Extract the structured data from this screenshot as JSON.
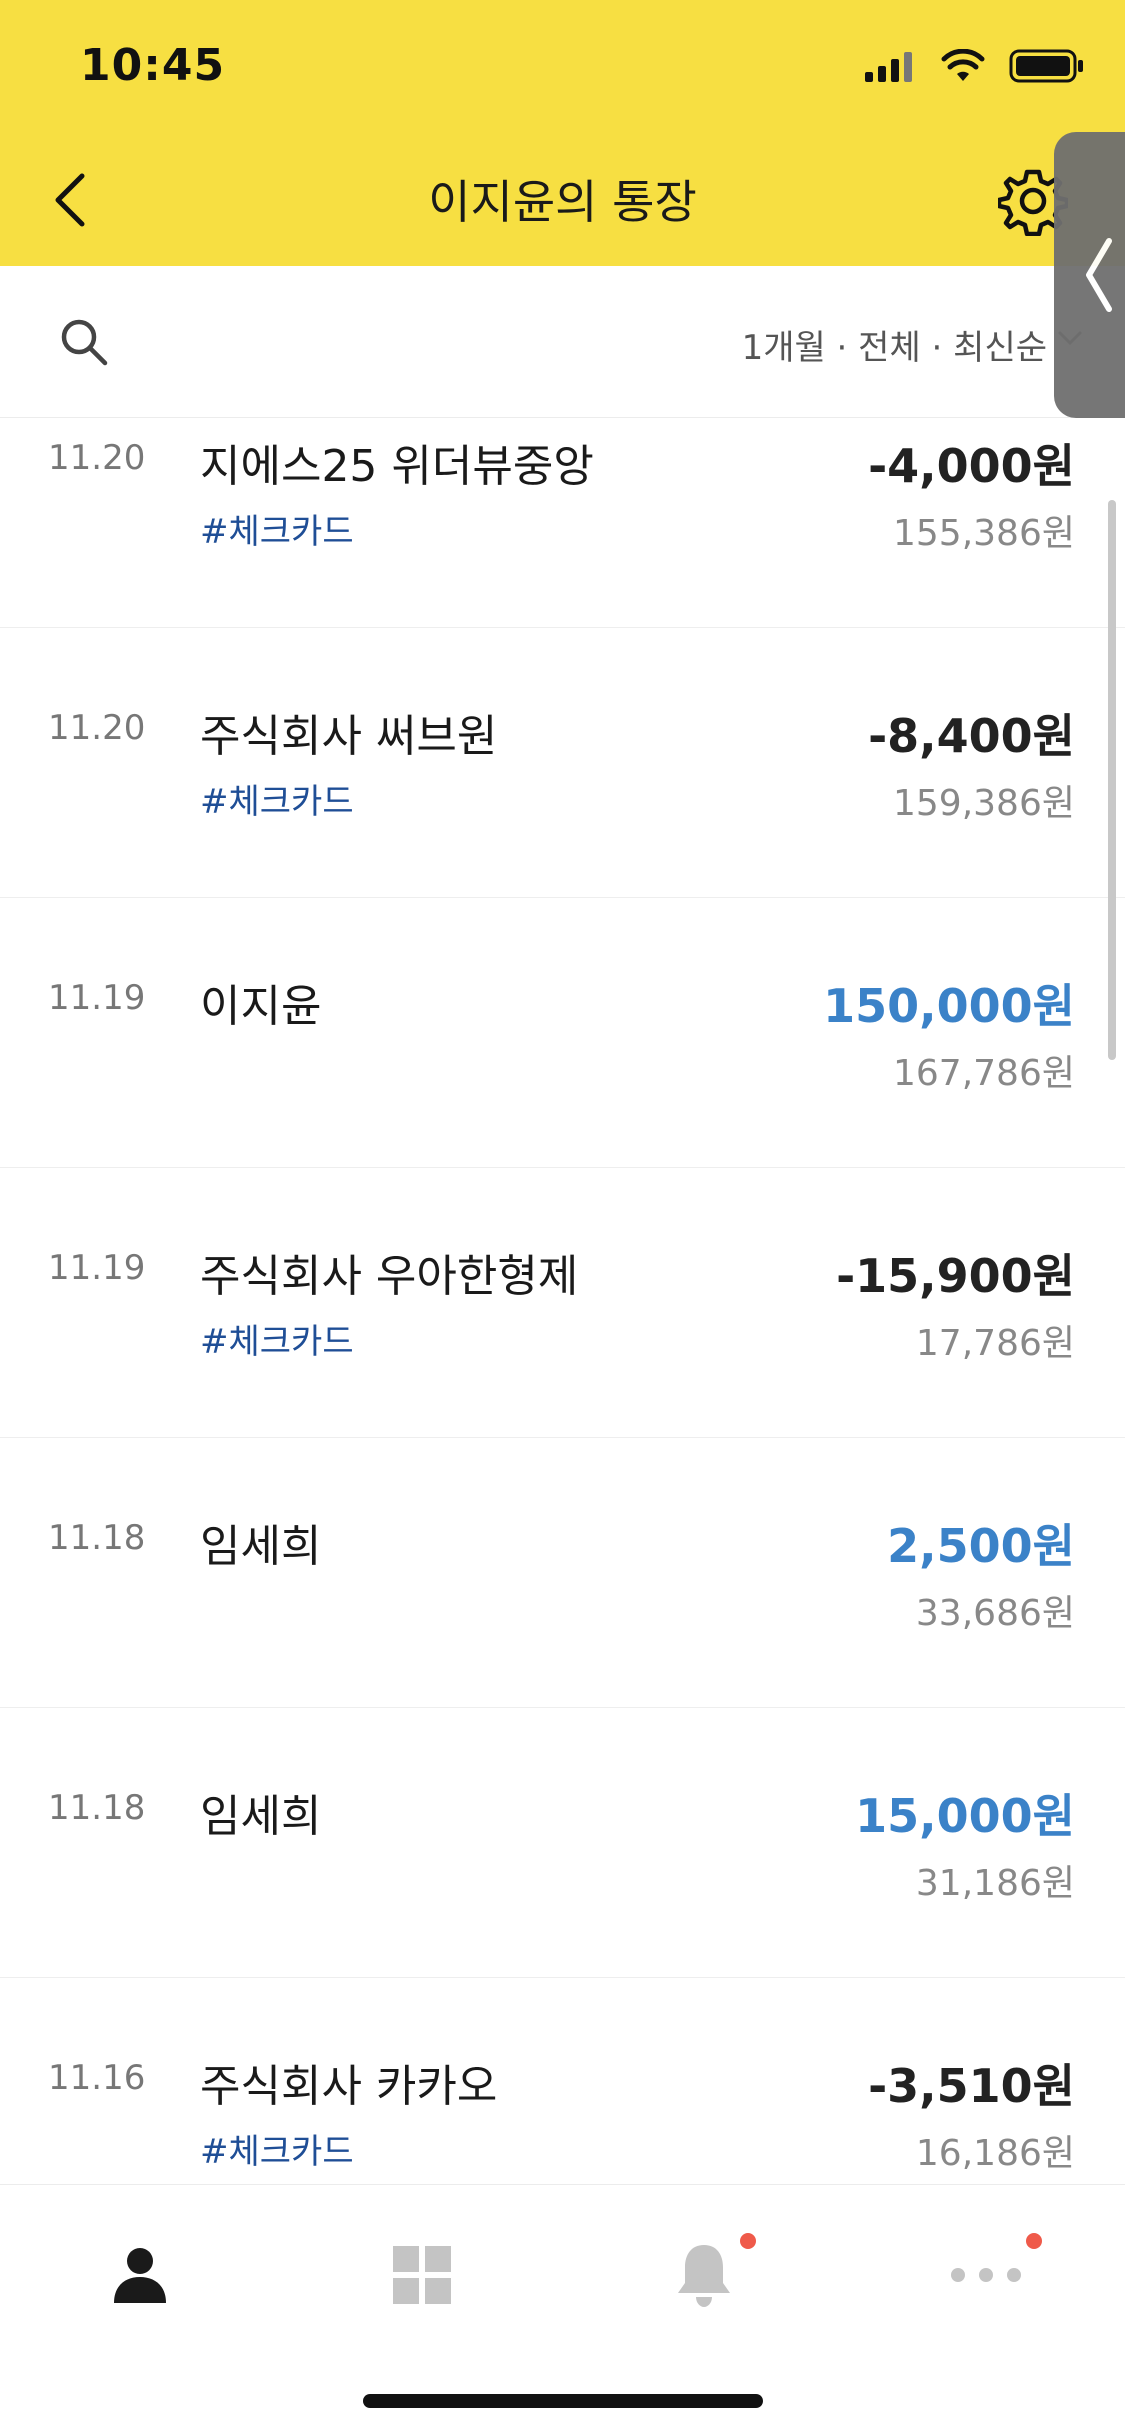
{
  "status_bar": {
    "time": "10:45"
  },
  "header": {
    "title": "이지윤의 통장"
  },
  "filter": {
    "label": "1개월 · 전체 · 최신순"
  },
  "transactions": [
    {
      "date": "11.20",
      "name": "지에스25 위더뷰중앙",
      "tag": "#체크카드",
      "amount": "-4,000원",
      "balance": "155,386원"
    },
    {
      "date": "11.20",
      "name": "주식회사 써브원",
      "tag": "#체크카드",
      "amount": "-8,400원",
      "balance": "159,386원"
    },
    {
      "date": "11.19",
      "name": "이지윤",
      "tag": "",
      "amount": "150,000원",
      "balance": "167,786원"
    },
    {
      "date": "11.19",
      "name": "주식회사 우아한형제",
      "tag": "#체크카드",
      "amount": "-15,900원",
      "balance": "17,786원"
    },
    {
      "date": "11.18",
      "name": "임세희",
      "tag": "",
      "amount": "2,500원",
      "balance": "33,686원"
    },
    {
      "date": "11.18",
      "name": "임세희",
      "tag": "",
      "amount": "15,000원",
      "balance": "31,186원"
    },
    {
      "date": "11.16",
      "name": "주식회사 카카오",
      "tag": "#체크카드",
      "amount": "-3,510원",
      "balance": "16,186원"
    }
  ],
  "colors": {
    "header_bg": "#f7df42",
    "positive_amount": "#3b82c8",
    "tag": "#1f4e96",
    "badge": "#ef5a4a"
  },
  "bottom_nav": [
    {
      "icon": "person-icon"
    },
    {
      "icon": "grid-icon"
    },
    {
      "icon": "bell-icon"
    },
    {
      "icon": "more-icon"
    }
  ]
}
